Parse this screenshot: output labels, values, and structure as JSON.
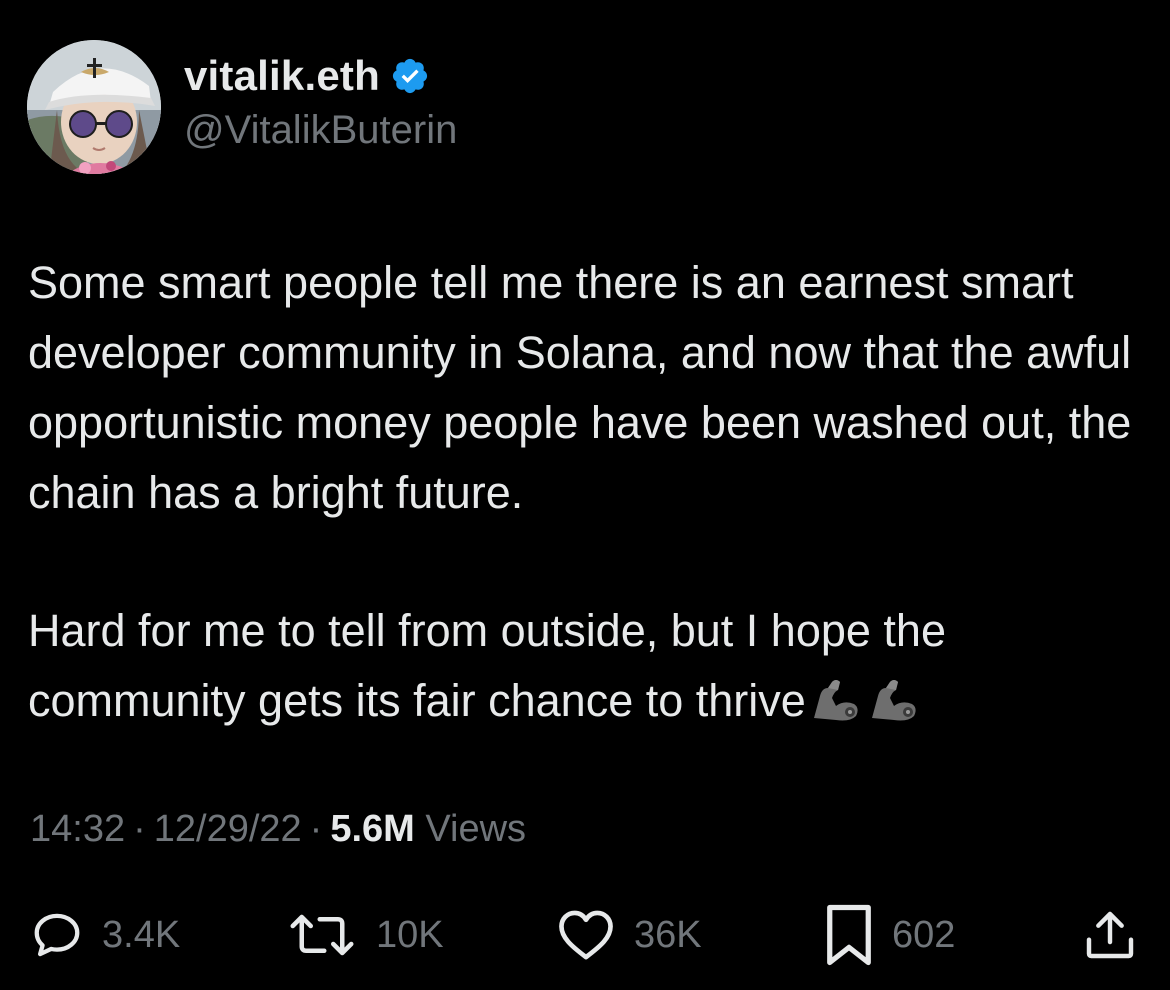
{
  "author": {
    "display_name": "vitalik.eth",
    "handle": "@VitalikButerin",
    "verified_color": "#1d9bf0"
  },
  "tweet": {
    "paragraph_1": "Some smart people tell me there is an earnest smart developer community in Solana, and now that the awful opportunistic money people have been washed out, the chain has a bright future.",
    "paragraph_2": "Hard for me to tell from outside, but I hope the community gets its fair chance to thrive",
    "emoji": [
      "flexed-biceps-icon",
      "flexed-biceps-icon"
    ]
  },
  "meta": {
    "time": "14:32",
    "separator": "·",
    "date": "12/29/22",
    "views_count": "5.6M",
    "views_label": "Views"
  },
  "actions": {
    "replies": "3.4K",
    "retweets": "10K",
    "likes": "36K",
    "bookmarks": "602"
  },
  "colors": {
    "background": "#000000",
    "primary_text": "#e7e9ea",
    "secondary_text": "#71767b",
    "accent": "#1d9bf0"
  }
}
